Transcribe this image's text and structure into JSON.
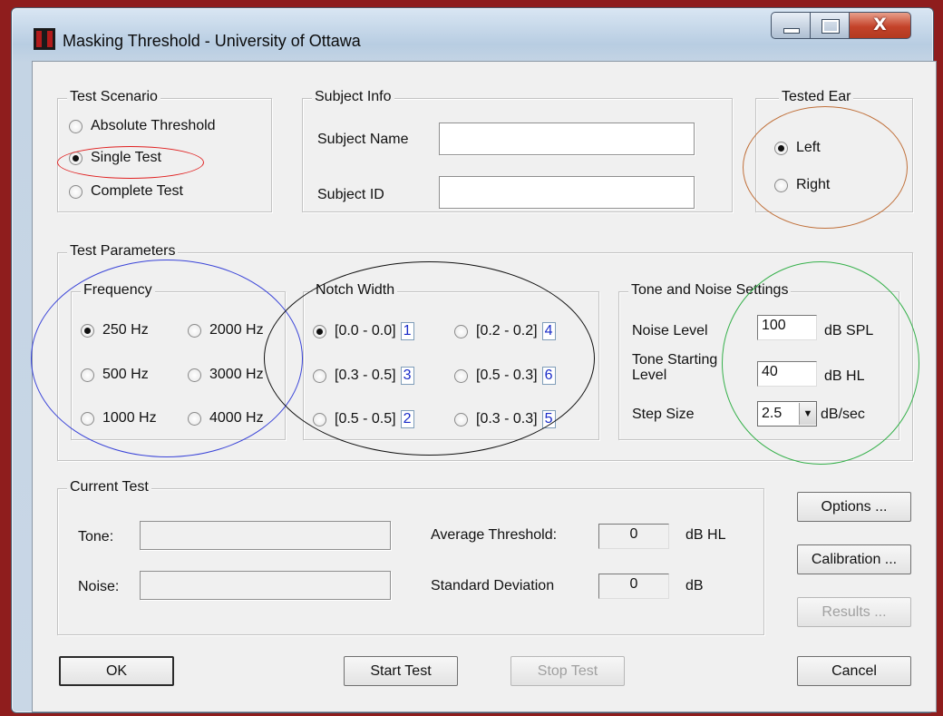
{
  "window": {
    "title": "Masking Threshold - University of Ottawa",
    "close_glyph": "X"
  },
  "test_scenario": {
    "legend": "Test Scenario",
    "options": [
      "Absolute Threshold",
      "Single Test",
      "Complete Test"
    ],
    "selected": "Single Test"
  },
  "subject_info": {
    "legend": "Subject Info",
    "name_label": "Subject Name",
    "name_value": "",
    "id_label": "Subject ID",
    "id_value": ""
  },
  "tested_ear": {
    "legend": "Tested Ear",
    "options": [
      "Left",
      "Right"
    ],
    "selected": "Left"
  },
  "test_parameters": {
    "legend": "Test Parameters",
    "frequency": {
      "legend": "Frequency",
      "options": [
        "250 Hz",
        "2000 Hz",
        "500 Hz",
        "3000 Hz",
        "1000 Hz",
        "4000 Hz"
      ],
      "selected": "250 Hz"
    },
    "notch_width": {
      "legend": "Notch Width",
      "options": [
        {
          "label": "[0.0 - 0.0]",
          "index": "1"
        },
        {
          "label": "[0.2 - 0.2]",
          "index": "4"
        },
        {
          "label": "[0.3 - 0.5]",
          "index": "3"
        },
        {
          "label": "[0.5 - 0.3]",
          "index": "6"
        },
        {
          "label": "[0.5 - 0.5]",
          "index": "2"
        },
        {
          "label": "[0.3 - 0.3]",
          "index": "5"
        }
      ],
      "selected": "[0.0 - 0.0]"
    },
    "tone_noise": {
      "legend": "Tone and Noise Settings",
      "noise_label": "Noise Level",
      "noise_value": "100",
      "noise_unit": "dB SPL",
      "tone_label_1": "Tone Starting",
      "tone_label_2": "Level",
      "tone_value": "40",
      "tone_unit": "dB HL",
      "step_label": "Step Size",
      "step_value": "2.5",
      "step_unit": "dB/sec"
    }
  },
  "current_test": {
    "legend": "Current Test",
    "tone_label": "Tone:",
    "tone_value": "",
    "noise_label": "Noise:",
    "noise_value": "",
    "avg_label": "Average Threshold:",
    "avg_value": "0",
    "avg_unit": "dB HL",
    "sd_label": "Standard Deviation",
    "sd_value": "0",
    "sd_unit": "dB"
  },
  "buttons": {
    "options": "Options ...",
    "calibration": "Calibration ...",
    "results": "Results ...",
    "ok": "OK",
    "start": "Start Test",
    "stop": "Stop Test",
    "cancel": "Cancel"
  },
  "annotation_colors": {
    "single_test": "#e02020",
    "tested_ear": "#c0703a",
    "frequency": "#3a44d8",
    "notch_width": "#111111",
    "tone_noise": "#35b04a"
  }
}
